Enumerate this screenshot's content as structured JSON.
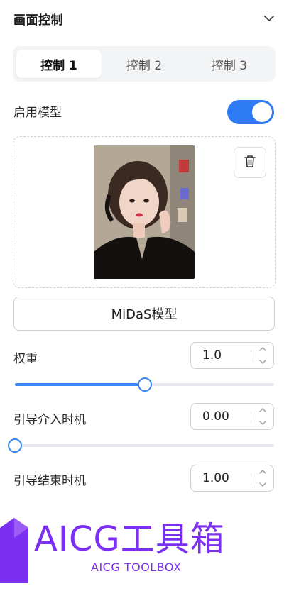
{
  "panel": {
    "title": "画面控制"
  },
  "tabs": [
    {
      "label": "控制 1",
      "active": true
    },
    {
      "label": "控制 2",
      "active": false
    },
    {
      "label": "控制 3",
      "active": false
    }
  ],
  "enable_model": {
    "label": "启用模型",
    "on": true
  },
  "image_upload": {
    "image_desc": "portrait-photo",
    "delete_icon": "trash-icon"
  },
  "model_button": {
    "label": "MiDaS模型"
  },
  "weight": {
    "label": "权重",
    "value": "1.0",
    "slider_fraction": 0.5
  },
  "guide_start": {
    "label": "引导介入时机",
    "value": "0.00",
    "slider_fraction": 0.0
  },
  "guide_end": {
    "label": "引导结束时机",
    "value": "1.00"
  },
  "watermark": {
    "title": "AICG工具箱",
    "subtitle": "AICG TOOLBOX"
  },
  "colors": {
    "accent": "#2f7bf6",
    "brand": "#7b2ff0"
  }
}
